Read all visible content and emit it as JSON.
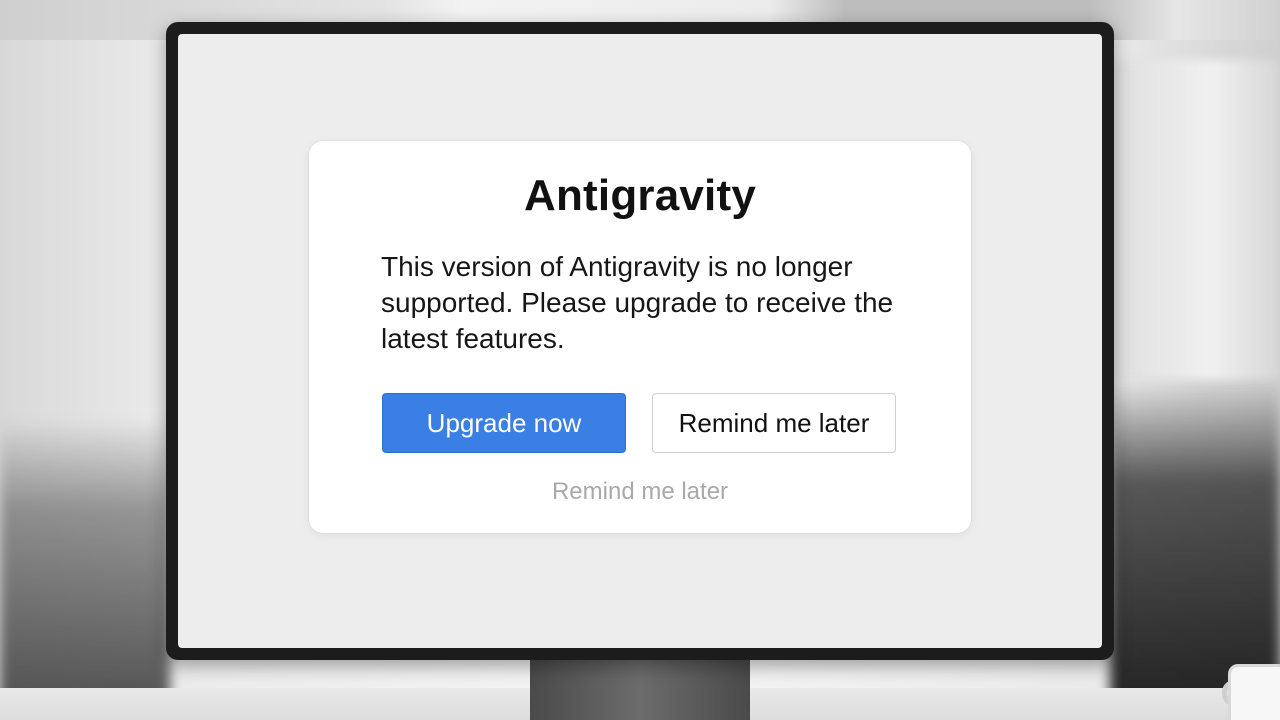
{
  "dialog": {
    "title": "Antigravity",
    "message": "This version of Antigravity is no longer supported. Please upgrade to receive the latest features.",
    "primary_button_label": "Upgrade now",
    "secondary_button_label": "Remind me later",
    "tertiary_link_label": "Remind me later"
  },
  "colors": {
    "accent": "#3a7fe4",
    "muted_text": "#a9a9a9"
  }
}
